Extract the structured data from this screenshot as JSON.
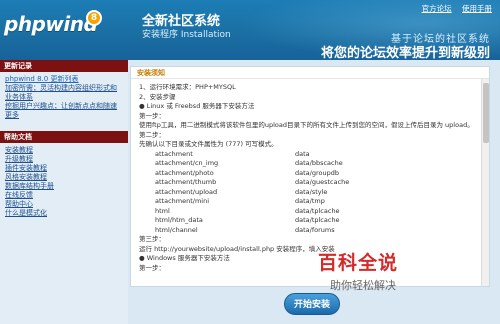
{
  "header": {
    "logo": "phpwind",
    "logo_version": "8",
    "title": "全新社区系统",
    "subtitle": "安装程序 Installation",
    "links": [
      "官方论坛",
      "使用手册"
    ],
    "slogan_line1": "基于论坛的社区系统",
    "slogan_line2": "将您的论坛效率提升到新级别"
  },
  "sidebar": {
    "updates_title": "更新记录",
    "updates": [
      "phpwind 8.0 更新列表",
      "加密所需；灵活构建内容组织形式和业务体系",
      "挖掘用户兴趣点；让创新点点和随速更多"
    ],
    "help_title": "帮助文档",
    "help": [
      "安装教程",
      "升级教程",
      "插件安装教程",
      "风格安装教程",
      "数据库结构手册",
      "在线反馈",
      "帮助中心",
      "什么是模式化"
    ]
  },
  "main": {
    "title": "安装须知",
    "lines": [
      "1、运行环境需求：PHP+MYSQL",
      "2、安装步骤",
      "● Linux 或 Freebsd 服务器下安装方法",
      "第一步：",
      "使用ftp工具，用二进制模式将该软件包里的upload目录下的所有文件上传到您的空间，假设上传后目录为 upload。",
      "第二步：",
      "先确认以下目录或文件属性为 (777) 可写模式。"
    ],
    "dirs_left": [
      "attachment",
      "attachment/cn_img",
      "attachment/photo",
      "attachment/thumb",
      "attachment/upload",
      "attachment/mini",
      "html",
      "html/htm_data",
      "html/channel"
    ],
    "dirs_right": [
      "data",
      "data/bbscache",
      "data/groupdb",
      "data/guestcache",
      "data/style",
      "data/tmp",
      "data/tplcache",
      "data/tplcache",
      "data/forums"
    ],
    "after_lines": [
      "第三步：",
      "运行 http://yourwebsite/upload/install.php 安装程序，填入安装",
      "● Windows 服务器下安装方法",
      "第一步："
    ]
  },
  "footer": {
    "install_button": "开始安装"
  },
  "watermark": {
    "main": "百科全说",
    "sub": "助你轻松解决"
  }
}
